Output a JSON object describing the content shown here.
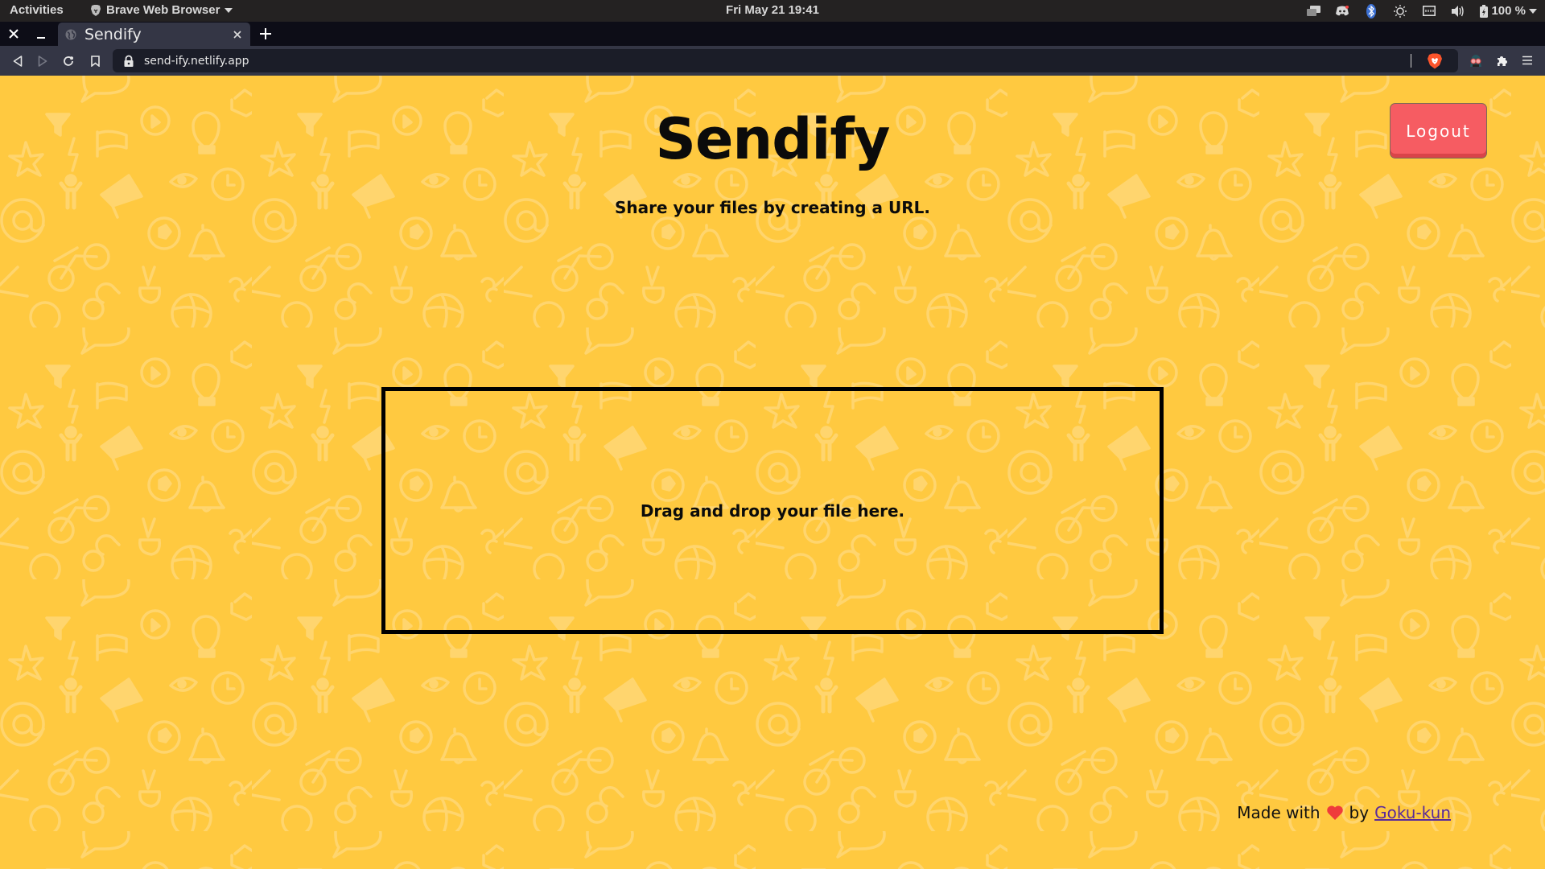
{
  "system_bar": {
    "activities_label": "Activities",
    "app_name": "Brave Web Browser",
    "clock": "Fri May 21  19:41",
    "battery_percent": "100 %",
    "tray_icons": [
      "workspace-icon",
      "discord-icon",
      "bluetooth-icon",
      "brightness-icon",
      "network-icon",
      "volume-icon",
      "battery-icon"
    ]
  },
  "browser": {
    "tab": {
      "title": "Sendify"
    },
    "url": "send-ify.netlify.app",
    "toolbar_icons": [
      "back-icon",
      "forward-icon",
      "reload-icon",
      "bookmark-icon",
      "brave-shields-icon",
      "extension-avatar-icon",
      "extensions-icon",
      "menu-icon"
    ]
  },
  "page": {
    "title": "Sendify",
    "subtitle": "Share your files by creating a URL.",
    "logout_label": "Logout",
    "dropzone_hint": "Drag and drop your file here.",
    "footer": {
      "prefix": "Made with",
      "by": "by",
      "author": "Goku-kun"
    },
    "colors": {
      "background": "#ffc940",
      "pattern": "#ffd56e",
      "logout": "#f65c62",
      "link": "#5a2a9a"
    }
  }
}
